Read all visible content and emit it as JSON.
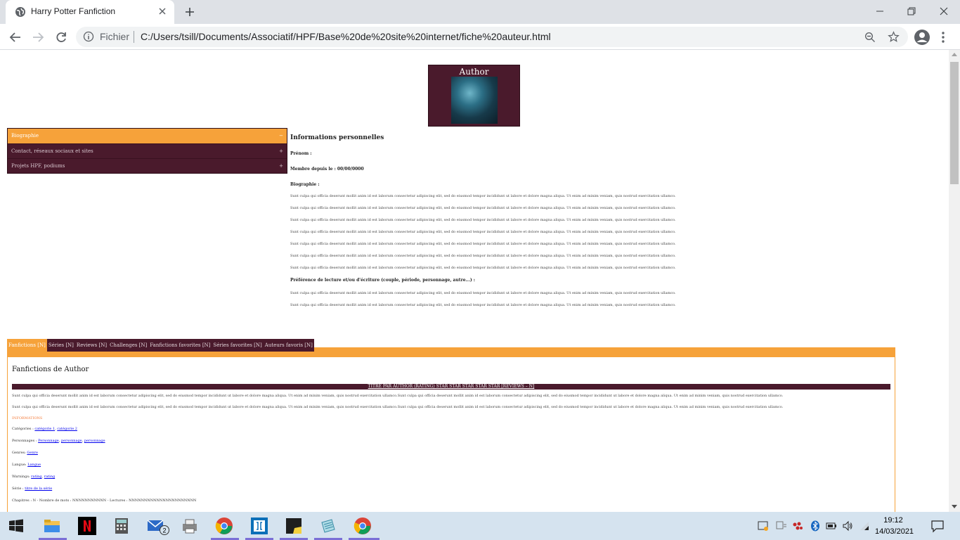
{
  "browser": {
    "tab_title": "Harry Potter Fanfiction",
    "scheme_label": "Fichier",
    "url": "C:/Users/tsill/Documents/Associatif/HPF/Base%20de%20site%20internet/fiche%20auteur.html"
  },
  "author": {
    "name": "Author"
  },
  "accordion": [
    {
      "label": "Biographie",
      "sign": "−",
      "active": true
    },
    {
      "label": "Contact, réseaux sociaux et sites",
      "sign": "+"
    },
    {
      "label": "Projets HPF, podiums",
      "sign": "+"
    }
  ],
  "info": {
    "heading": "Informations personnelles",
    "prenom": "Prénom :",
    "membre": "Membre depuis le : 00/00/0000",
    "bio_label": "Biographie :",
    "bio_paragraphs": [
      "Sunt culpa qui officia deserunt mollit anim id est laborum consectetur adipiscing elit, sed do eiusmod tempor incididunt ut labore et dolore magna aliqua. Ut enim ad minim veniam, quis nostrud exercitation ullamco.",
      "Sunt culpa qui officia deserunt mollit anim id est laborum consectetur adipiscing elit, sed do eiusmod tempor incididunt ut labore et dolore magna aliqua. Ut enim ad minim veniam, quis nostrud exercitation ullamco.",
      "Sunt culpa qui officia deserunt mollit anim id est laborum consectetur adipiscing elit, sed do eiusmod tempor incididunt ut labore et dolore magna aliqua. Ut enim ad minim veniam, quis nostrud exercitation ullamco.",
      "Sunt culpa qui officia deserunt mollit anim id est laborum consectetur adipiscing elit, sed do eiusmod tempor incididunt ut labore et dolore magna aliqua. Ut enim ad minim veniam, quis nostrud exercitation ullamco.",
      "Sunt culpa qui officia deserunt mollit anim id est laborum consectetur adipiscing elit, sed do eiusmod tempor incididunt ut labore et dolore magna aliqua. Ut enim ad minim veniam, quis nostrud exercitation ullamco.",
      "Sunt culpa qui officia deserunt mollit anim id est laborum consectetur adipiscing elit, sed do eiusmod tempor incididunt ut labore et dolore magna aliqua. Ut enim ad minim veniam, quis nostrud exercitation ullamco.",
      "Sunt culpa qui officia deserunt mollit anim id est laborum consectetur adipiscing elit, sed do eiusmod tempor incididunt ut labore et dolore magna aliqua. Ut enim ad minim veniam, quis nostrud exercitation ullamco."
    ],
    "pref_label": "Préférence de lecture et/ou d'écriture (couple, période, personnage, autre...) :",
    "pref_paragraphs": [
      "Sunt culpa qui officia deserunt mollit anim id est laborum consectetur adipiscing elit, sed do eiusmod tempor incididunt ut labore et dolore magna aliqua. Ut enim ad minim veniam, quis nostrud exercitation ullamco.",
      "Sunt culpa qui officia deserunt mollit anim id est laborum consectetur adipiscing elit, sed do eiusmod tempor incididunt ut labore et dolore magna aliqua. Ut enim ad minim veniam, quis nostrud exercitation ullamco."
    ]
  },
  "tabs": [
    "Fanfictions [N]",
    "Séries [N]",
    "Reviews [N]",
    "Challenges [N]",
    "Fanfictions favorites [N]",
    "Séries favorites [N]",
    "Auteurs favoris [N]"
  ],
  "panel": {
    "heading": "Fanfictions de Author",
    "fic_title": "TITRE PAR AUTHOR (RATING) STAR STAR STAR STAR STAR [REVIEWS – N]",
    "summary1": "Sunt culpa qui officia deserunt mollit anim id est laborum consectetur adipiscing elit, sed do eiusmod tempor incididunt ut labore et dolore magna aliqua. Ut enim ad minim veniam, quis nostrud exercitation ullamco.Sunt culpa qui officia deserunt mollit anim id est laborum consectetur adipiscing elit, sed do eiusmod tempor incididunt ut labore et dolore magna aliqua. Ut enim ad minim veniam, quis nostrud exercitation ullamco.",
    "summary2": "Sunt culpa qui officia deserunt mollit anim id est laborum consectetur adipiscing elit, sed do eiusmod tempor incididunt ut labore et dolore magna aliqua. Ut enim ad minim veniam, quis nostrud exercitation ullamco.Sunt culpa qui officia deserunt mollit anim id est laborum consectetur adipiscing elit, sed do eiusmod tempor incididunt ut labore et dolore magna aliqua. Ut enim ad minim veniam, quis nostrud exercitation ullamco.",
    "informations": "INFORMATIONS",
    "categories_label": "Catégories :",
    "categories": [
      "catégorie 1",
      "catégorie 2"
    ],
    "personnages_label": "Personnages :",
    "personnages": [
      "Personnage",
      "personnage",
      "personnage"
    ],
    "genres_label": "Genres:",
    "genres": [
      "Genre"
    ],
    "langue_label": "Langue:",
    "langue": [
      "Langue"
    ],
    "warnings_label": "Warnings:",
    "warnings": [
      "rating",
      "rating"
    ],
    "serie_label": "Série :",
    "serie": [
      "titre de la série"
    ],
    "chapitres": "Chapitres : N - Nombre de mots : NNNNNNNNNNN - Lectures : NNNNNNNNNNNNNNNNNNNNNN"
  },
  "taskbar": {
    "time": "19:12",
    "date": "14/03/2021",
    "mail_badge": "2"
  },
  "colors": {
    "plum": "#4a1a2c",
    "orange": "#f6a23a"
  }
}
